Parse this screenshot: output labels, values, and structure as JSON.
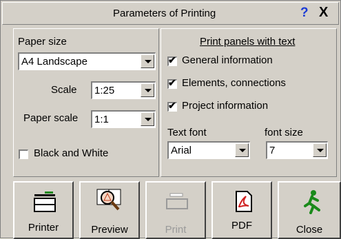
{
  "window": {
    "title": "Parameters of Printing",
    "help": "?",
    "close": "X"
  },
  "left": {
    "paper_size_label": "Paper size",
    "paper_size_value": "A4 Landscape",
    "scale_label": "Scale",
    "scale_value": "1:25",
    "paper_scale_label": "Paper scale",
    "paper_scale_value": "1:1",
    "bw_label": "Black and White",
    "bw_checked": false
  },
  "right": {
    "heading": "Print panels with text",
    "options": [
      {
        "label": "General information",
        "checked": true
      },
      {
        "label": "Elements, connections",
        "checked": true
      },
      {
        "label": "Project information",
        "checked": true
      }
    ],
    "text_font_label": "Text font",
    "text_font_value": "Arial",
    "font_size_label": "font size",
    "font_size_value": "7"
  },
  "buttons": {
    "printer": "Printer",
    "preview": "Preview",
    "print": "Print",
    "pdf": "PDF",
    "close": "Close"
  },
  "icons": [
    "printer-icon",
    "preview-magnifier-icon",
    "print-disabled-icon",
    "pdf-icon",
    "exit-running-man-icon"
  ]
}
